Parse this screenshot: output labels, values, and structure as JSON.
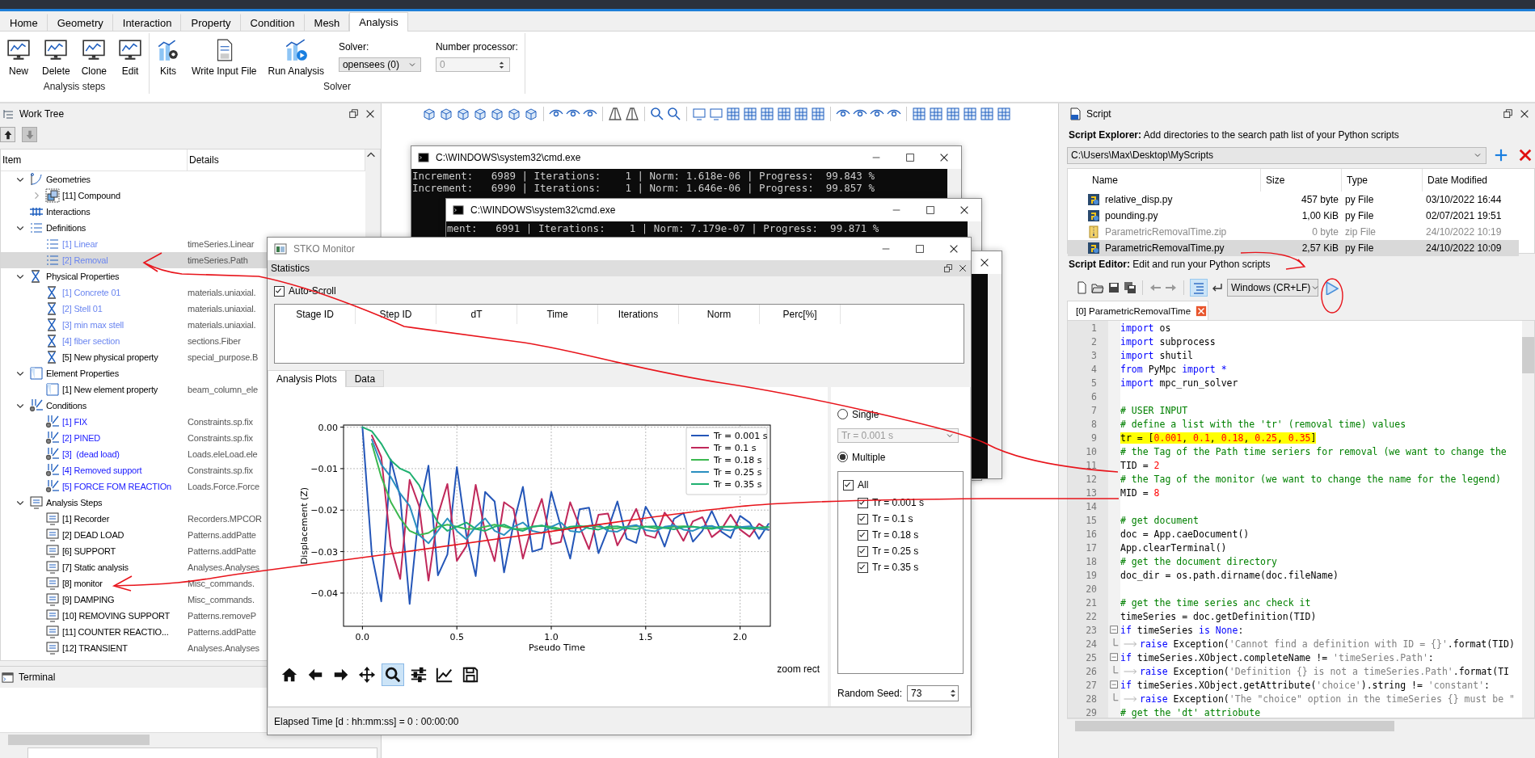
{
  "ribbon": {
    "tabs": [
      {
        "label": "Home",
        "selected": false
      },
      {
        "label": "Geometry",
        "selected": false
      },
      {
        "label": "Interaction",
        "selected": false
      },
      {
        "label": "Property",
        "selected": false
      },
      {
        "label": "Condition",
        "selected": false
      },
      {
        "label": "Mesh",
        "selected": false
      },
      {
        "label": "Analysis",
        "selected": true
      }
    ],
    "groups": [
      {
        "label": "Analysis steps",
        "buttons": [
          {
            "label": "New",
            "kind": "new"
          },
          {
            "label": "Delete",
            "kind": "delete"
          },
          {
            "label": "Clone",
            "kind": "clone"
          },
          {
            "label": "Edit",
            "kind": "edit"
          }
        ]
      },
      {
        "label": "Solver",
        "buttons": [
          {
            "label": "Kits",
            "kind": "kits"
          },
          {
            "label": "Write Input File",
            "kind": "write"
          },
          {
            "label": "Run Analysis",
            "kind": "run"
          }
        ],
        "fields": [
          {
            "label": "Solver:",
            "value": "opensees (0)",
            "kind": "combo",
            "disabled": false
          },
          {
            "label": "Number processor:",
            "value": "0",
            "kind": "spin",
            "disabled": true
          }
        ]
      }
    ]
  },
  "work_tree": {
    "title": "Work Tree",
    "columns": [
      "Item",
      "Details"
    ],
    "items": [
      {
        "label": "Geometries",
        "kind": "geometry",
        "expanded": true,
        "selected": false,
        "children": [
          {
            "label": "[11] Compound",
            "kind": "compound",
            "expanded": false,
            "selected": false
          }
        ]
      },
      {
        "label": "Interactions",
        "kind": "interaction",
        "selected": false
      },
      {
        "label": "Definitions",
        "kind": "definition",
        "expanded": true,
        "selected": false,
        "children": [
          {
            "label": "[1] Linear",
            "details": "timeSeries.Linear",
            "kind": "definition",
            "color": "#6b86f0",
            "selected": false
          },
          {
            "label": "[2] Removal",
            "details": "timeSeries.Path",
            "kind": "definition",
            "color": "#6b86f0",
            "selected": true
          }
        ]
      },
      {
        "label": "Physical Properties",
        "kind": "property",
        "expanded": true,
        "selected": false,
        "children": [
          {
            "label": "[1] Concrete 01",
            "details": "materials.uniaxial.",
            "kind": "property",
            "color": "#6b86f0",
            "selected": false
          },
          {
            "label": "[2] Stell 01",
            "details": "materials.uniaxial.",
            "kind": "property",
            "color": "#6b86f0",
            "selected": false
          },
          {
            "label": "[3] min max stell",
            "details": "materials.uniaxial.",
            "kind": "property",
            "color": "#6b86f0",
            "selected": false
          },
          {
            "label": "[4] fiber section",
            "details": "sections.Fiber",
            "kind": "property",
            "color": "#6b86f0",
            "selected": false
          },
          {
            "label": "[5] New physical property",
            "details": "special_purpose.B",
            "kind": "property",
            "selected": false
          }
        ]
      },
      {
        "label": "Element Properties",
        "kind": "element",
        "expanded": true,
        "selected": false,
        "children": [
          {
            "label": "[1] New element property",
            "details": "beam_column_ele",
            "kind": "element",
            "selected": false
          }
        ]
      },
      {
        "label": "Conditions",
        "kind": "condition",
        "expanded": true,
        "selected": false,
        "children": [
          {
            "label": "[1] FIX",
            "details": "Constraints.sp.fix",
            "kind": "condition",
            "color": "#1a1aff",
            "selected": false
          },
          {
            "label": "[2] PINED",
            "details": "Constraints.sp.fix",
            "kind": "condition",
            "color": "#1a1aff",
            "selected": false
          },
          {
            "label": "[3]  (dead load)",
            "details": "Loads.eleLoad.ele",
            "kind": "condition",
            "color": "#1a1aff",
            "selected": false
          },
          {
            "label": "[4] Removed support",
            "details": "Constraints.sp.fix",
            "kind": "condition",
            "color": "#1a1aff",
            "selected": false
          },
          {
            "label": "[5] FORCE FOM REACTIOn",
            "details": "Loads.Force.Force",
            "kind": "condition",
            "color": "#1a1aff",
            "selected": false
          }
        ]
      },
      {
        "label": "Analysis Steps",
        "kind": "step",
        "expanded": true,
        "selected": false,
        "children": [
          {
            "label": "[1] Recorder",
            "details": "Recorders.MPCOR",
            "kind": "step",
            "selected": false
          },
          {
            "label": "[2] DEAD LOAD",
            "details": "Patterns.addPatte",
            "kind": "step",
            "selected": false
          },
          {
            "label": "[6] SUPPORT",
            "details": "Patterns.addPatte",
            "kind": "step",
            "selected": false
          },
          {
            "label": "[7] Static analysis",
            "details": "Analyses.Analyses",
            "kind": "step",
            "selected": false
          },
          {
            "label": "[8] monitor",
            "details": "Misc_commands.",
            "kind": "step",
            "selected": false
          },
          {
            "label": "[9] DAMPING",
            "details": "Misc_commands.",
            "kind": "step",
            "selected": false
          },
          {
            "label": "[10] REMOVING SUPPORT",
            "details": "Patterns.removeP",
            "kind": "step",
            "selected": false
          },
          {
            "label": "[11] COUNTER REACTIO...",
            "details": "Patterns.addPatte",
            "kind": "step",
            "selected": false
          },
          {
            "label": "[12] TRANSIENT",
            "details": "Analyses.Analyses",
            "kind": "step",
            "selected": false
          }
        ]
      }
    ]
  },
  "terminal": {
    "title": "Terminal"
  },
  "cmd_windows": [
    {
      "title": "C:\\WINDOWS\\system32\\cmd.exe",
      "lines": [
        "Increment:   6989 | Iterations:    1 | Norm: 1.618e-06 | Progress:  99.843 %",
        "Increment:   6990 | Iterations:    1 | Norm: 1.646e-06 | Progress:  99.857 %"
      ]
    },
    {
      "title": "C:\\WINDOWS\\system32\\cmd.exe",
      "lines": [
        "ment:   6991 | Iterations:    1 | Norm: 7.179e-07 | Progress:  99.871 %"
      ]
    }
  ],
  "monitor": {
    "title": "STKO Monitor",
    "statistics": {
      "title": "Statistics",
      "auto_scroll": {
        "label": "Auto-Scroll",
        "checked": true
      },
      "columns": [
        "Stage ID",
        "Step ID",
        "dT",
        "Time",
        "Iterations",
        "Norm",
        "Perc[%]"
      ]
    },
    "tabs": [
      {
        "label": "Analysis Plots",
        "selected": true
      },
      {
        "label": "Data",
        "selected": false
      }
    ],
    "chart_data": {
      "type": "line",
      "xlabel": "Pseudo Time",
      "ylabel": "Displacement (Z)",
      "xlim": [
        -0.1,
        2.16
      ],
      "ylim": [
        -0.048,
        0.0005
      ],
      "grid": true,
      "legend": "upper right",
      "xticks": [
        {
          "value": 0,
          "label": "0.0"
        },
        {
          "value": 0.5,
          "label": "0.5"
        },
        {
          "value": 1,
          "label": "1.0"
        },
        {
          "value": 1.5,
          "label": "1.5"
        },
        {
          "value": 2,
          "label": "2.0"
        }
      ],
      "yticks": [
        {
          "value": 0,
          "label": "0.00"
        },
        {
          "value": -0.01,
          "label": "−0.01"
        },
        {
          "value": -0.02,
          "label": "−0.02"
        },
        {
          "value": -0.03,
          "label": "−0.03"
        },
        {
          "value": -0.04,
          "label": "−0.04"
        }
      ],
      "x": [
        0,
        0.05,
        0.1,
        0.15,
        0.2,
        0.25,
        0.3,
        0.35,
        0.4,
        0.45,
        0.5,
        0.55,
        0.6,
        0.65,
        0.7,
        0.75,
        0.8,
        0.85,
        0.9,
        0.95,
        1,
        1.05,
        1.1,
        1.15,
        1.2,
        1.25,
        1.3,
        1.35,
        1.4,
        1.45,
        1.5,
        1.55,
        1.6,
        1.65,
        1.7,
        1.75,
        1.8,
        1.85,
        1.9,
        1.95,
        2,
        2.05,
        2.1,
        2.15
      ],
      "series": [
        {
          "name": "Tr = 0.001 s",
          "color": "#2456b8",
          "values": [
            0,
            -0.0307,
            -0.042,
            -0.0078,
            -0.0168,
            -0.0426,
            -0.02,
            -0.0093,
            -0.0357,
            -0.0307,
            -0.0096,
            -0.0259,
            -0.0359,
            -0.0156,
            -0.0179,
            -0.035,
            -0.0233,
            -0.0144,
            -0.03,
            -0.0293,
            -0.0156,
            -0.0239,
            -0.0317,
            -0.0198,
            -0.0194,
            -0.0304,
            -0.0246,
            -0.0179,
            -0.0269,
            -0.0279,
            -0.0192,
            -0.0231,
            -0.0288,
            -0.0221,
            -0.0207,
            -0.0276,
            -0.025,
            -0.0202,
            -0.0252,
            -0.0267,
            -0.0214,
            -0.023,
            -0.0269,
            -0.0233
          ]
        },
        {
          "name": "Tr = 0.1 s",
          "color": "#c0285a",
          "values": [
            null,
            -0.002,
            -0.0072,
            -0.0287,
            -0.0366,
            -0.0127,
            -0.019,
            -0.037,
            -0.0212,
            -0.0137,
            -0.0322,
            -0.0287,
            -0.0139,
            -0.0253,
            -0.0323,
            -0.0181,
            -0.0197,
            -0.0317,
            -0.0235,
            -0.0173,
            -0.0282,
            -0.0277,
            -0.0181,
            -0.0239,
            -0.0294,
            -0.0211,
            -0.0208,
            -0.0285,
            -0.0244,
            -0.0197,
            -0.026,
            -0.0267,
            -0.0206,
            -0.0234,
            -0.0274,
            -0.0227,
            -0.0217,
            -0.0265,
            -0.0247,
            -0.0211,
            -0.0247,
            -0.0264,
            -0.0233,
            -0.0248
          ]
        },
        {
          "name": "Tr = 0.18 s",
          "color": "#3cb84f",
          "values": [
            null,
            -0.004,
            -0.012,
            -0.018,
            -0.022,
            -0.025,
            -0.026,
            -0.0255,
            -0.024,
            -0.0235,
            -0.024,
            -0.0245,
            -0.0245,
            -0.024,
            -0.0235,
            -0.024,
            -0.0245,
            -0.0245,
            -0.024,
            -0.0238,
            -0.024,
            -0.0245,
            -0.0244,
            -0.024,
            -0.0238,
            -0.024,
            -0.0244,
            -0.0244,
            -0.024,
            -0.0239,
            -0.024,
            -0.0244,
            -0.0243,
            -0.024,
            -0.0239,
            -0.024,
            -0.0243,
            -0.0243,
            -0.024,
            -0.024,
            -0.024,
            -0.0243,
            -0.0243,
            -0.0241
          ]
        },
        {
          "name": "Tr = 0.25 s",
          "color": "#2a8fc0",
          "values": [
            null,
            -0.003,
            -0.009,
            -0.012,
            -0.016,
            -0.019,
            -0.026,
            -0.028,
            -0.025,
            -0.022,
            -0.025,
            -0.027,
            -0.024,
            -0.022,
            -0.025,
            -0.026,
            -0.024,
            -0.023,
            -0.025,
            -0.0255,
            -0.024,
            -0.023,
            -0.025,
            -0.0253,
            -0.0238,
            -0.0235,
            -0.025,
            -0.0252,
            -0.024,
            -0.0236,
            -0.0248,
            -0.0251,
            -0.024,
            -0.0237,
            -0.0247,
            -0.025,
            -0.024,
            -0.0238,
            -0.0246,
            -0.0249,
            -0.0241,
            -0.0239,
            -0.0245,
            -0.0247
          ]
        },
        {
          "name": "Tr = 0.35 s",
          "color": "#1fb070",
          "values": [
            0,
            -0.001,
            -0.004,
            -0.008,
            -0.01,
            -0.011,
            -0.014,
            -0.019,
            -0.023,
            -0.025,
            -0.024,
            -0.023,
            -0.0245,
            -0.025,
            -0.024,
            -0.0235,
            -0.0245,
            -0.025,
            -0.024,
            -0.0237,
            -0.0244,
            -0.0248,
            -0.024,
            -0.0238,
            -0.0244,
            -0.0247,
            -0.024,
            -0.0239,
            -0.0244,
            -0.0246,
            -0.024,
            -0.0239,
            -0.0243,
            -0.0246,
            -0.0241,
            -0.024,
            -0.0243,
            -0.0245,
            -0.0241,
            -0.024,
            -0.0243,
            -0.0245,
            -0.0242,
            -0.0241
          ]
        }
      ]
    },
    "plot_tools": [
      {
        "kind": "home",
        "active": false
      },
      {
        "kind": "back",
        "active": false
      },
      {
        "kind": "forward",
        "active": false
      },
      {
        "kind": "pan",
        "active": false
      },
      {
        "kind": "zoom",
        "active": true
      },
      {
        "kind": "sliders",
        "active": false
      },
      {
        "kind": "lines",
        "active": false
      },
      {
        "kind": "save",
        "active": false
      }
    ],
    "mode": "zoom rect",
    "options": {
      "single": {
        "label": "Single",
        "selected": false
      },
      "series_select": {
        "value": "Tr = 0.001 s",
        "disabled": true
      },
      "multiple": {
        "label": "Multiple",
        "selected": true
      },
      "items": [
        {
          "label": "All",
          "checked": true,
          "children": [
            {
              "label": "Tr = 0.001 s",
              "checked": true
            },
            {
              "label": "Tr = 0.1 s",
              "checked": true
            },
            {
              "label": "Tr = 0.18 s",
              "checked": true
            },
            {
              "label": "Tr = 0.25 s",
              "checked": true
            },
            {
              "label": "Tr = 0.35 s",
              "checked": true
            }
          ]
        }
      ],
      "random_seed": {
        "label": "Random Seed:",
        "value": "73"
      }
    },
    "elapsed": "Elapsed Time [d : hh:mm:ss] = 0 : 00:00:00"
  },
  "script": {
    "title": "Script",
    "explorer_label": "**Script Explorer:** Add directories to the search path list of your Python scripts",
    "path": "C:\\Users\\Max\\Desktop\\MyScripts",
    "file_columns": [
      "Name",
      "Size",
      "Type",
      "Date Modified"
    ],
    "files": [
      {
        "name": "relative_disp.py",
        "size": "457 byte",
        "type": "py File",
        "date": "03/10/2022 16:44",
        "kind": "py",
        "dimmed": false,
        "selected": false
      },
      {
        "name": "pounding.py",
        "size": "1,00 KiB",
        "type": "py File",
        "date": "02/07/2021 19:51",
        "kind": "py",
        "dimmed": false,
        "selected": false
      },
      {
        "name": "ParametricRemovalTime.zip",
        "size": "0 byte",
        "type": "zip File",
        "date": "24/10/2022 10:19",
        "kind": "zip",
        "dimmed": true,
        "selected": false
      },
      {
        "name": "ParametricRemovalTime.py",
        "size": "2,57 KiB",
        "type": "py File",
        "date": "24/10/2022 10:09",
        "kind": "py",
        "dimmed": false,
        "selected": true
      }
    ],
    "editor_label": "**Script Editor:** Edit and run your Python scripts",
    "line_ending": "Windows (CR+LF)",
    "tab": "[0] ParametricRemovalTime",
    "lines": [
      {
        "n": "1",
        "kind": "plain",
        "highlighted": false,
        "tokens": [
          {
            "text": "import",
            "kind": "keyword"
          },
          {
            "text": " os",
            "kind": "plain"
          }
        ]
      },
      {
        "n": "2",
        "kind": "plain",
        "highlighted": false,
        "tokens": [
          {
            "text": "import",
            "kind": "keyword"
          },
          {
            "text": " subprocess",
            "kind": "plain"
          }
        ]
      },
      {
        "n": "3",
        "kind": "plain",
        "highlighted": false,
        "tokens": [
          {
            "text": "import",
            "kind": "keyword"
          },
          {
            "text": " shutil",
            "kind": "plain"
          }
        ]
      },
      {
        "n": "4",
        "kind": "plain",
        "highlighted": false,
        "tokens": [
          {
            "text": "from",
            "kind": "keyword"
          },
          {
            "text": " PyMpc ",
            "kind": "plain"
          },
          {
            "text": "import",
            "kind": "keyword"
          },
          {
            "text": " *",
            "kind": "keyword"
          }
        ]
      },
      {
        "n": "5",
        "kind": "plain",
        "highlighted": false,
        "tokens": [
          {
            "text": "import",
            "kind": "keyword"
          },
          {
            "text": " mpc_run_solver",
            "kind": "plain"
          }
        ]
      },
      {
        "n": "6",
        "kind": "plain",
        "highlighted": false
      },
      {
        "n": "7",
        "kind": "plain",
        "highlighted": false,
        "tokens": [
          {
            "text": "# USER INPUT",
            "kind": "comment"
          }
        ]
      },
      {
        "n": "8",
        "kind": "plain",
        "highlighted": false,
        "tokens": [
          {
            "text": "# define a list with the 'tr' (removal time) values",
            "kind": "comment"
          }
        ]
      },
      {
        "n": "9",
        "kind": "plain",
        "highlighted": true,
        "tokens": [
          {
            "text": "tr = [",
            "kind": "plain"
          },
          {
            "text": "0.001",
            "kind": "number"
          },
          {
            "text": ", ",
            "kind": "plain"
          },
          {
            "text": "0.1",
            "kind": "number"
          },
          {
            "text": ", ",
            "kind": "plain"
          },
          {
            "text": "0.18",
            "kind": "number"
          },
          {
            "text": ", ",
            "kind": "plain"
          },
          {
            "text": "0.25",
            "kind": "number"
          },
          {
            "text": ", ",
            "kind": "plain"
          },
          {
            "text": "0.35",
            "kind": "number"
          },
          {
            "text": "]",
            "kind": "plain"
          }
        ]
      },
      {
        "n": "10",
        "kind": "plain",
        "highlighted": false,
        "tokens": [
          {
            "text": "# the Tag of the Path time seriers for removal (we want to change the",
            "kind": "comment"
          }
        ]
      },
      {
        "n": "11",
        "kind": "plain",
        "highlighted": false,
        "tokens": [
          {
            "text": "TID = ",
            "kind": "plain"
          },
          {
            "text": "2",
            "kind": "number"
          }
        ]
      },
      {
        "n": "12",
        "kind": "plain",
        "highlighted": false,
        "tokens": [
          {
            "text": "# the Tag of the monitor (we want to change the name for the legend)",
            "kind": "comment"
          }
        ]
      },
      {
        "n": "13",
        "kind": "plain",
        "highlighted": false,
        "tokens": [
          {
            "text": "MID = ",
            "kind": "plain"
          },
          {
            "text": "8",
            "kind": "number"
          }
        ]
      },
      {
        "n": "14",
        "kind": "plain",
        "highlighted": false
      },
      {
        "n": "15",
        "kind": "plain",
        "highlighted": false,
        "tokens": [
          {
            "text": "# get document",
            "kind": "comment"
          }
        ]
      },
      {
        "n": "16",
        "kind": "plain",
        "highlighted": false,
        "tokens": [
          {
            "text": "doc = App.caeDocument()",
            "kind": "plain"
          }
        ]
      },
      {
        "n": "17",
        "kind": "plain",
        "highlighted": false,
        "tokens": [
          {
            "text": "App.clearTerminal()",
            "kind": "plain"
          }
        ]
      },
      {
        "n": "18",
        "kind": "plain",
        "highlighted": false,
        "tokens": [
          {
            "text": "# get the document directory",
            "kind": "comment"
          }
        ]
      },
      {
        "n": "19",
        "kind": "plain",
        "highlighted": false,
        "tokens": [
          {
            "text": "doc_dir = os.path.dirname(doc.fileName)",
            "kind": "plain"
          }
        ]
      },
      {
        "n": "20",
        "kind": "plain",
        "highlighted": false
      },
      {
        "n": "21",
        "kind": "plain",
        "highlighted": false,
        "tokens": [
          {
            "text": "# get the time series anc check it",
            "kind": "comment"
          }
        ]
      },
      {
        "n": "22",
        "kind": "plain",
        "highlighted": false,
        "tokens": [
          {
            "text": "timeSeries = doc.getDefinition(TID)",
            "kind": "plain"
          }
        ]
      },
      {
        "n": "23",
        "kind": "fold_start",
        "highlighted": false,
        "tokens": [
          {
            "text": "if",
            "kind": "keyword"
          },
          {
            "text": " timeSeries ",
            "kind": "plain"
          },
          {
            "text": "is",
            "kind": "keyword"
          },
          {
            "text": " None",
            "kind": "keyword"
          },
          {
            "text": ":",
            "kind": "plain"
          }
        ]
      },
      {
        "n": "24",
        "kind": "fold_end",
        "highlighted": false,
        "tokens": [
          {
            "text": "raise",
            "kind": "keyword"
          },
          {
            "text": " Exception(",
            "kind": "plain"
          },
          {
            "text": "'Cannot find a definition with ID = {}'",
            "kind": "string"
          },
          {
            "text": ".format(TID)",
            "kind": "plain"
          }
        ]
      },
      {
        "n": "25",
        "kind": "fold_start",
        "highlighted": false,
        "tokens": [
          {
            "text": "if",
            "kind": "keyword"
          },
          {
            "text": " timeSeries.XObject.completeName != ",
            "kind": "plain"
          },
          {
            "text": "'timeSeries.Path'",
            "kind": "string"
          },
          {
            "text": ":",
            "kind": "plain"
          }
        ]
      },
      {
        "n": "26",
        "kind": "fold_end",
        "highlighted": false,
        "tokens": [
          {
            "text": "raise",
            "kind": "keyword"
          },
          {
            "text": " Exception(",
            "kind": "plain"
          },
          {
            "text": "'Definition {} is not a timeSeries.Path'",
            "kind": "string"
          },
          {
            "text": ".format(TI",
            "kind": "plain"
          }
        ]
      },
      {
        "n": "27",
        "kind": "fold_start",
        "highlighted": false,
        "tokens": [
          {
            "text": "if",
            "kind": "keyword"
          },
          {
            "text": " timeSeries.XObject.getAttribute(",
            "kind": "plain"
          },
          {
            "text": "'choice'",
            "kind": "string"
          },
          {
            "text": ").string != ",
            "kind": "plain"
          },
          {
            "text": "'constant'",
            "kind": "string"
          },
          {
            "text": ":",
            "kind": "plain"
          }
        ]
      },
      {
        "n": "28",
        "kind": "fold_end",
        "highlighted": false,
        "tokens": [
          {
            "text": "raise",
            "kind": "keyword"
          },
          {
            "text": " Exception(",
            "kind": "plain"
          },
          {
            "text": "'The \"choice\" option in the timeSeries {} must be \"",
            "kind": "string"
          }
        ]
      },
      {
        "n": "29",
        "kind": "plain",
        "highlighted": false,
        "tokens": [
          {
            "text": "# get the 'dt' attriobute",
            "kind": "comment"
          }
        ]
      }
    ]
  }
}
